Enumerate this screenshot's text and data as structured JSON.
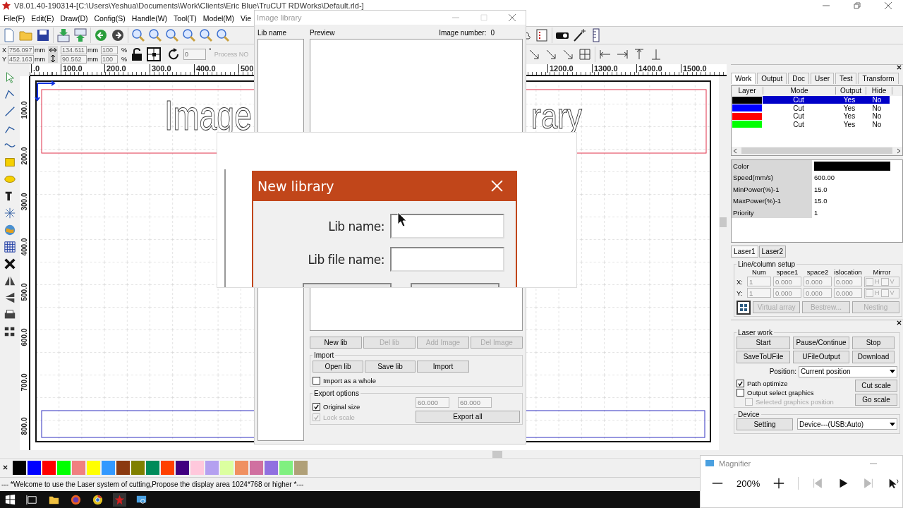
{
  "window": {
    "title": "V8.01.40-190314-[C:\\Users\\Yeshua\\Documents\\Work\\Clients\\Eric Blue\\TruCUT RDWorks\\Default.rld-]"
  },
  "menu": [
    "File(F)",
    "Edit(E)",
    "Draw(D)",
    "Config(S)",
    "Handle(W)",
    "Tool(T)",
    "Model(M)",
    "Vie"
  ],
  "position": {
    "coords": [
      {
        "axis": "X",
        "value": "756.097",
        "unit": "mm"
      },
      {
        "axis": "Y",
        "value": "452.163",
        "unit": "mm"
      }
    ],
    "sizes": [
      {
        "value": "134.611",
        "unit": "mm"
      },
      {
        "value": "90.562",
        "unit": "mm"
      }
    ],
    "scales": [
      {
        "value": "100",
        "unit": "%"
      },
      {
        "value": "100",
        "unit": "%"
      }
    ],
    "rotation": {
      "value": "0",
      "unit": "°"
    },
    "process_label": "Process NO"
  },
  "ruler": {
    "h_labels": [
      ".0",
      "100.0",
      "200.0",
      "300.0",
      "400.0",
      "500",
      "1200.0",
      "1300.0",
      "1400.0",
      "1500.0"
    ],
    "v_labels": [
      "100.0",
      "200.0",
      "300.0",
      "400.0",
      "500.0",
      "600.0",
      "700.0",
      "800.0"
    ]
  },
  "canvas": {
    "texts": [
      "Image",
      "rary"
    ]
  },
  "palette": [
    {
      "color": "#000000"
    },
    {
      "color": "#0000ff"
    },
    {
      "color": "#ff0000"
    },
    {
      "color": "#00ff00"
    },
    {
      "color": "#f08080"
    },
    {
      "color": "#ffff00"
    },
    {
      "color": "#3399ff"
    },
    {
      "color": "#8b3a10"
    },
    {
      "color": "#808000"
    },
    {
      "color": "#008b5a"
    },
    {
      "color": "#ff4000"
    },
    {
      "color": "#400080"
    },
    {
      "color": "#ffc8dc"
    },
    {
      "color": "#b4a0f0"
    },
    {
      "color": "#dcffa0"
    },
    {
      "color": "#f09060"
    },
    {
      "color": "#d070a0"
    },
    {
      "color": "#9070e0"
    },
    {
      "color": "#80f080"
    },
    {
      "color": "#b0a078"
    }
  ],
  "status_bar": "--- *Welcome to use the Laser system of cutting,Propose the display area 1024*768 or higher *---",
  "side_panel": {
    "tabs": [
      {
        "label": "Work",
        "selected": true
      },
      {
        "label": "Output",
        "selected": false
      },
      {
        "label": "Doc",
        "selected": false
      },
      {
        "label": "User",
        "selected": false
      },
      {
        "label": "Test",
        "selected": false
      },
      {
        "label": "Transform",
        "selected": false
      }
    ],
    "layer_table": {
      "columns": [
        "Layer",
        "Mode",
        "Output",
        "Hide"
      ],
      "rows": [
        {
          "color": "#000000",
          "mode": "Cut",
          "output": "Yes",
          "hide": "No",
          "selected": true
        },
        {
          "color": "#0000ff",
          "mode": "Cut",
          "output": "Yes",
          "hide": "No",
          "selected": false
        },
        {
          "color": "#ff0000",
          "mode": "Cut",
          "output": "Yes",
          "hide": "No",
          "selected": false
        },
        {
          "color": "#00ff00",
          "mode": "Cut",
          "output": "Yes",
          "hide": "No",
          "selected": false
        }
      ]
    },
    "properties": [
      {
        "label": "Color",
        "kind": "swatch",
        "color": "#000000"
      },
      {
        "label": "Speed(mm/s)",
        "kind": "text",
        "value": "600.00"
      },
      {
        "label": "MinPower(%)-1",
        "kind": "text",
        "value": "15.0"
      },
      {
        "label": "MaxPower(%)-1",
        "kind": "text",
        "value": "15.0"
      },
      {
        "label": "Priority",
        "kind": "text",
        "value": "1"
      }
    ],
    "laser_tabs": [
      {
        "label": "Laser1",
        "selected": true
      },
      {
        "label": "Laser2",
        "selected": false
      }
    ],
    "array_setup": {
      "title": "Line/column setup",
      "columns": [
        "Num",
        "space1",
        "space2",
        "islocation",
        "Mirror"
      ],
      "rows": [
        {
          "axis": "X:",
          "num": "1",
          "space1": "0.000",
          "space2": "0.000",
          "dislocation": "0.000",
          "mirror": [
            {
              "label": "H",
              "checked": false
            },
            {
              "label": "V",
              "checked": false
            }
          ]
        },
        {
          "axis": "Y:",
          "num": "1",
          "space1": "0.000",
          "space2": "0.000",
          "dislocation": "0.000",
          "mirror": [
            {
              "label": "H",
              "checked": false
            },
            {
              "label": "V",
              "checked": false
            }
          ]
        }
      ],
      "buttons": [
        {
          "label": "Virtual array",
          "disabled": true
        },
        {
          "label": "Bestrew...",
          "disabled": true
        },
        {
          "label": "Nesting",
          "disabled": true
        }
      ]
    }
  },
  "laser_work": {
    "title": "Laser work",
    "buttons": [
      "Start",
      "Pause/Continue",
      "Stop",
      "SaveToUFile",
      "UFileOutput",
      "Download"
    ],
    "position_label": "Position:",
    "position_value": "Current position",
    "options": [
      {
        "label": "Path optimize",
        "checked": true,
        "disabled": false
      },
      {
        "label": "Output select graphics",
        "checked": false,
        "disabled": false
      },
      {
        "label": "Selected graphics position",
        "checked": false,
        "disabled": true
      }
    ],
    "scale_buttons": [
      "Cut scale",
      "Go scale"
    ]
  },
  "device": {
    "title": "Device",
    "button": "Setting",
    "value": "Device---(USB:Auto)"
  },
  "image_library": {
    "title": "Image library",
    "lib_label": "Lib name",
    "preview_label": "Preview",
    "count_label": "Image number:",
    "count": "0",
    "buttons": [
      {
        "label": "New lib",
        "disabled": false
      },
      {
        "label": "Del lib",
        "disabled": true
      },
      {
        "label": "Add Image",
        "disabled": true
      },
      {
        "label": "Del Image",
        "disabled": true
      }
    ],
    "import": {
      "title": "Import",
      "buttons": [
        "Open lib",
        "Save lib",
        "Import"
      ],
      "whole": {
        "label": "Import as a whole",
        "checked": false
      }
    },
    "export": {
      "title": "Export options",
      "options": [
        {
          "label": "Original size",
          "checked": true,
          "disabled": false
        },
        {
          "label": "Lock scale",
          "checked": true,
          "disabled": true
        }
      ],
      "fields": [
        "60.000",
        "60.000"
      ],
      "button": "Export all"
    }
  },
  "new_library": {
    "title": "New library",
    "fields": [
      {
        "label": "Lib name:"
      },
      {
        "label": "Lib file name:"
      }
    ]
  },
  "magnifier": {
    "title": "Magnifier",
    "zoom": "200%"
  }
}
